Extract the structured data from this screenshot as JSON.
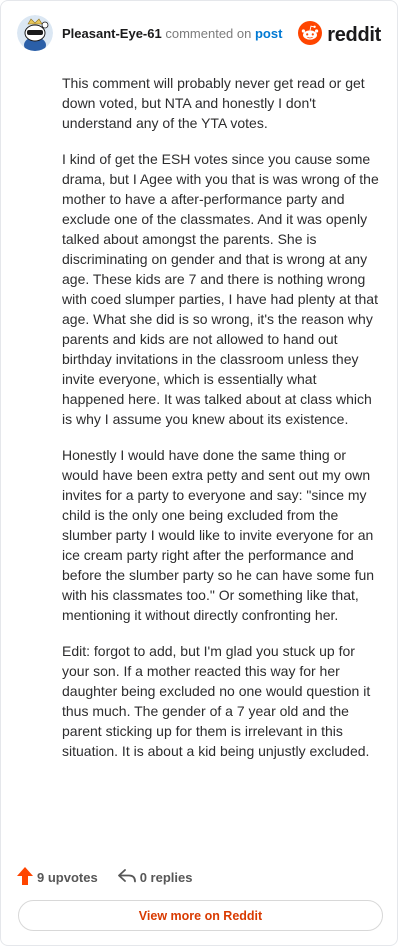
{
  "header": {
    "username": "Pleasant-Eye-61",
    "action_text": "commented on",
    "post_link": "post",
    "brand_name": "reddit",
    "avatar_icon": "snoo-avatar-icon",
    "brand_icon": "reddit-logo-icon"
  },
  "comment": {
    "paragraphs": [
      "This comment will probably never get read or get down voted, but NTA and honestly I don't understand any of the YTA votes.",
      "I kind of get the ESH votes since you cause some drama, but I Agee with you that is was wrong of the mother to have a after-performance party and exclude one of the classmates. And it was openly talked about amongst the parents. She is discriminating on gender and that is wrong at any age. These kids are 7 and there is nothing wrong with coed slumper parties, I have had plenty at that age. What she did is so wrong, it's the reason why parents and kids are not allowed to hand out birthday invitations in the classroom unless they invite everyone, which is essentially what happened here. It was talked about at class which is why I assume you knew about its existence.",
      "Honestly I would have done the same thing or would have been extra petty and sent out my own invites for a party to everyone and say: \"since my child is the only one being excluded from the slumber party I would like to invite everyone for an ice cream party right after the performance and before the slumber party so he can have some fun with his classmates too.\" Or something like that, mentioning it without directly confronting her.",
      "Edit: forgot to add, but I'm glad you stuck up for your son. If a mother reacted this way for her daughter being excluded no one would question it thus much. The gender of a 7 year old and the parent sticking up for them is irrelevant in this situation. It is about a kid being unjustly excluded."
    ]
  },
  "footer": {
    "upvotes": "9 upvotes",
    "replies": "0 replies",
    "view_more": "View more on Reddit",
    "upvote_icon": "upvote-arrow-icon",
    "reply_icon": "reply-arrow-icon"
  },
  "colors": {
    "brand_orange": "#ff4500",
    "link_blue": "#0079d3",
    "view_more_text": "#d93a00"
  }
}
